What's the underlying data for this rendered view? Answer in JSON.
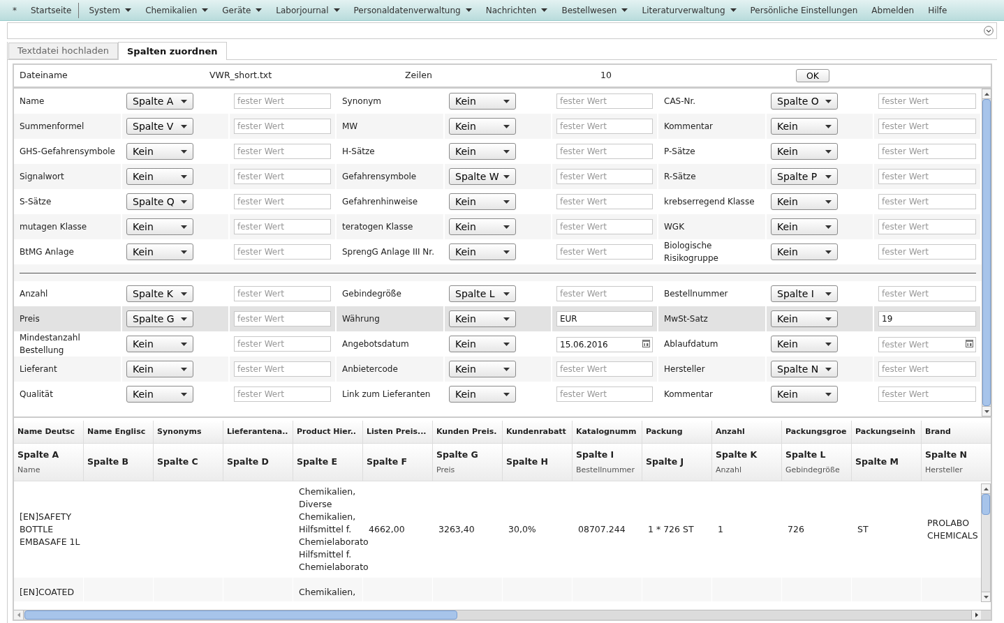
{
  "menu": [
    {
      "label": "*",
      "has_menu": false,
      "separator_after": false
    },
    {
      "label": "Startseite",
      "has_menu": false,
      "separator_after": true
    },
    {
      "label": "System",
      "has_menu": true,
      "separator_after": false
    },
    {
      "label": "Chemikalien",
      "has_menu": true,
      "separator_after": false
    },
    {
      "label": "Geräte",
      "has_menu": true,
      "separator_after": false
    },
    {
      "label": "Laborjournal",
      "has_menu": true,
      "separator_after": false
    },
    {
      "label": "Personaldatenverwaltung",
      "has_menu": true,
      "separator_after": false
    },
    {
      "label": "Nachrichten",
      "has_menu": true,
      "separator_after": false
    },
    {
      "label": "Bestellwesen",
      "has_menu": true,
      "separator_after": false
    },
    {
      "label": "Literaturverwaltung",
      "has_menu": true,
      "separator_after": false
    },
    {
      "label": "Persönliche Einstellungen",
      "has_menu": false,
      "separator_after": false
    },
    {
      "label": "Abmelden",
      "has_menu": false,
      "separator_after": false
    },
    {
      "label": "Hilfe",
      "has_menu": false,
      "separator_after": false
    }
  ],
  "tabs": [
    {
      "label": "Textdatei hochladen",
      "selected": false
    },
    {
      "label": "Spalten zuordnen",
      "selected": true
    }
  ],
  "file_info": {
    "filename_label": "Dateiname",
    "filename": "VWR_short.txt",
    "rows_label": "Zeilen",
    "rows": "10",
    "ok_button": "OK"
  },
  "mapping_groups": [
    {
      "rows": [
        {
          "highlighted": false,
          "fields": [
            {
              "label": "Name",
              "select": "Spalte A",
              "kind": "text",
              "placeholder": "fester Wert"
            },
            {
              "label": "Synonym",
              "select": "Kein",
              "kind": "text",
              "placeholder": "fester Wert"
            },
            {
              "label": "CAS-Nr.",
              "select": "Spalte O",
              "kind": "text",
              "placeholder": "fester Wert"
            }
          ]
        },
        {
          "highlighted": false,
          "fields": [
            {
              "label": "Summenformel",
              "select": "Spalte V",
              "kind": "text",
              "placeholder": "fester Wert"
            },
            {
              "label": "MW",
              "select": "Kein",
              "kind": "text",
              "placeholder": "fester Wert"
            },
            {
              "label": "Kommentar",
              "select": "Kein",
              "kind": "text",
              "placeholder": "fester Wert"
            }
          ]
        },
        {
          "highlighted": false,
          "fields": [
            {
              "label": "GHS-Gefahrensymbole",
              "select": "Kein",
              "kind": "text",
              "placeholder": "fester Wert"
            },
            {
              "label": "H-Sätze",
              "select": "Kein",
              "kind": "text",
              "placeholder": "fester Wert"
            },
            {
              "label": "P-Sätze",
              "select": "Kein",
              "kind": "text",
              "placeholder": "fester Wert"
            }
          ]
        },
        {
          "highlighted": false,
          "fields": [
            {
              "label": "Signalwort",
              "select": "Kein",
              "kind": "text",
              "placeholder": "fester Wert"
            },
            {
              "label": "Gefahrensymbole",
              "select": "Spalte W",
              "kind": "text",
              "placeholder": "fester Wert"
            },
            {
              "label": "R-Sätze",
              "select": "Spalte P",
              "kind": "text",
              "placeholder": "fester Wert"
            }
          ]
        },
        {
          "highlighted": false,
          "fields": [
            {
              "label": "S-Sätze",
              "select": "Spalte Q",
              "kind": "text",
              "placeholder": "fester Wert"
            },
            {
              "label": "Gefahrenhinweise",
              "select": "Kein",
              "kind": "text",
              "placeholder": "fester Wert"
            },
            {
              "label": "krebserregend Klasse",
              "select": "Kein",
              "kind": "text",
              "placeholder": "fester Wert"
            }
          ]
        },
        {
          "highlighted": false,
          "fields": [
            {
              "label": "mutagen Klasse",
              "select": "Kein",
              "kind": "text",
              "placeholder": "fester Wert"
            },
            {
              "label": "teratogen Klasse",
              "select": "Kein",
              "kind": "text",
              "placeholder": "fester Wert"
            },
            {
              "label": "WGK",
              "select": "Kein",
              "kind": "text",
              "placeholder": "fester Wert"
            }
          ]
        },
        {
          "highlighted": false,
          "fields": [
            {
              "label": "BtMG Anlage",
              "select": "Kein",
              "kind": "text",
              "placeholder": "fester Wert"
            },
            {
              "label": "SprengG Anlage III Nr.",
              "select": "Kein",
              "kind": "text",
              "placeholder": "fester Wert"
            },
            {
              "label": "Biologische Risikogruppe",
              "select": "Kein",
              "kind": "text",
              "placeholder": "fester Wert"
            }
          ]
        }
      ]
    },
    {
      "rows": [
        {
          "highlighted": false,
          "fields": [
            {
              "label": "Anzahl",
              "select": "Spalte K",
              "kind": "text",
              "placeholder": "fester Wert"
            },
            {
              "label": "Gebindegröße",
              "select": "Spalte L",
              "kind": "text",
              "placeholder": "fester Wert"
            },
            {
              "label": "Bestellnummer",
              "select": "Spalte I",
              "kind": "text",
              "placeholder": "fester Wert"
            }
          ]
        },
        {
          "highlighted": true,
          "fields": [
            {
              "label": "Preis",
              "select": "Spalte G",
              "kind": "text",
              "placeholder": "fester Wert"
            },
            {
              "label": "Währung",
              "select": "Kein",
              "kind": "text",
              "value": "EUR"
            },
            {
              "label": "MwSt-Satz",
              "select": "Kein",
              "kind": "text",
              "value": "19"
            }
          ]
        },
        {
          "highlighted": false,
          "fields": [
            {
              "label": "Mindestanzahl Bestellung",
              "select": "Kein",
              "kind": "text",
              "placeholder": "fester Wert"
            },
            {
              "label": "Angebotsdatum",
              "select": "Kein",
              "kind": "date",
              "value": "15.06.2016"
            },
            {
              "label": "Ablaufdatum",
              "select": "Kein",
              "kind": "date",
              "placeholder": "fester Wert"
            }
          ]
        },
        {
          "highlighted": false,
          "fields": [
            {
              "label": "Lieferant",
              "select": "Kein",
              "kind": "text",
              "placeholder": "fester Wert"
            },
            {
              "label": "Anbietercode",
              "select": "Kein",
              "kind": "text",
              "placeholder": "fester Wert"
            },
            {
              "label": "Hersteller",
              "select": "Spalte N",
              "kind": "text",
              "placeholder": "fester Wert"
            }
          ]
        },
        {
          "highlighted": false,
          "fields": [
            {
              "label": "Qualität",
              "select": "Kein",
              "kind": "text",
              "placeholder": "fester Wert"
            },
            {
              "label": "Link zum Lieferanten",
              "select": "Kein",
              "kind": "text",
              "placeholder": "fester Wert"
            },
            {
              "label": "Kommentar",
              "select": "Kein",
              "kind": "text",
              "placeholder": "fester Wert"
            }
          ]
        }
      ]
    }
  ],
  "preview_table": {
    "columns": [
      {
        "header": "Name Deutsc",
        "column": "Spalte A",
        "mapped_to": "Name"
      },
      {
        "header": "Name Englisc",
        "column": "Spalte B"
      },
      {
        "header": "Synonyms",
        "column": "Spalte C"
      },
      {
        "header": "Lieferantena..",
        "column": "Spalte D"
      },
      {
        "header": "Product Hier..",
        "column": "Spalte E"
      },
      {
        "header": "Listen Preis...",
        "column": "Spalte F"
      },
      {
        "header": "Kunden Preis.",
        "column": "Spalte G",
        "mapped_to": "Preis"
      },
      {
        "header": "Kundenrabatt",
        "column": "Spalte H"
      },
      {
        "header": "Katalognumm",
        "column": "Spalte I",
        "mapped_to": "Bestellnummer"
      },
      {
        "header": "Packung",
        "column": "Spalte J"
      },
      {
        "header": "Anzahl",
        "column": "Spalte K",
        "mapped_to": "Anzahl"
      },
      {
        "header": "Packungsgroe",
        "column": "Spalte L",
        "mapped_to": "Gebindegröße"
      },
      {
        "header": "Packungseinh",
        "column": "Spalte M"
      },
      {
        "header": "Brand",
        "column": "Spalte N",
        "mapped_to": "Hersteller"
      }
    ],
    "rows": [
      [
        "[EN]SAFETY\nBOTTLE\nEMBASAFE 1L",
        "",
        "",
        "",
        "Chemikalien,\nDiverse\nChemikalien,\nHilfsmittel f.\nChemielaborato\nHilfsmittel f.\nChemielaborato",
        "4662,00",
        "3263,40",
        "30,0%",
        "08707.244",
        "1 * 726 ST",
        "1",
        "726",
        "ST",
        "PROLABO\nCHEMICALS"
      ],
      [
        "[EN]COATED",
        "",
        "",
        "",
        "Chemikalien,",
        "",
        "",
        "",
        "",
        "",
        "",
        "",
        "",
        ""
      ]
    ]
  }
}
